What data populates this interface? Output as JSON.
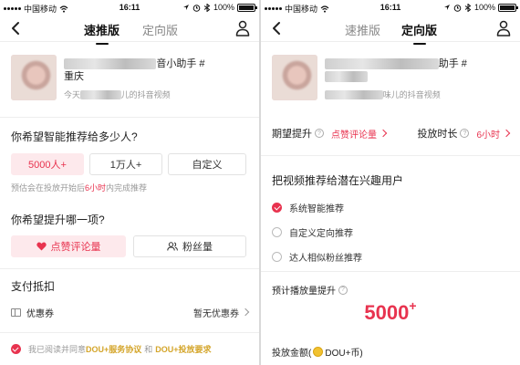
{
  "status": {
    "carrier": "中国移动",
    "time": "16:11",
    "battery": "100%"
  },
  "left": {
    "tabs": [
      "速推版",
      "定向版"
    ],
    "active_tab": 0,
    "video": {
      "title_line1_visible": "音小助手 #",
      "title_line2": "重庆",
      "subtitle_prefix": "今天",
      "subtitle_suffix": "儿的抖音视频"
    },
    "q1": "你希望智能推荐给多少人?",
    "q1_options": [
      "5000人+",
      "1万人+",
      "自定义"
    ],
    "q1_selected": 0,
    "hint_before": "预估会在投放开始后",
    "hint_highlight": "6小时",
    "hint_after": "内完成推荐",
    "q2": "你希望提升哪一项?",
    "q2_options": [
      "点赞评论量",
      "粉丝量"
    ],
    "q2_selected": 0,
    "pay_title": "支付抵扣",
    "coupon_label": "优惠券",
    "coupon_value": "暂无优惠券",
    "agree_prefix": "我已阅读并同意",
    "agree_link1": "DOU+服务协议",
    "agree_and": "和",
    "agree_link2": "DOU+投放要求"
  },
  "right": {
    "tabs": [
      "速推版",
      "定向版"
    ],
    "active_tab": 1,
    "video": {
      "title_line1_visible": "助手 #",
      "subtitle_suffix": "味儿的抖音视频"
    },
    "expect_label": "期望提升",
    "expect_value": "点赞评论量",
    "duration_label": "投放时长",
    "duration_value": "6小时",
    "q": "把视频推荐给潜在兴趣用户",
    "options": [
      "系统智能推荐",
      "自定义定向推荐",
      "达人相似粉丝推荐"
    ],
    "selected": 0,
    "forecast_label": "预计播放量提升",
    "forecast_value": "5000",
    "forecast_suffix": "+",
    "amount_label": "投放金额(",
    "amount_unit": "DOU+币)"
  },
  "colors": {
    "accent": "#e8334f",
    "accent_bg": "#fde9ec",
    "gold": "#d4a52a"
  }
}
